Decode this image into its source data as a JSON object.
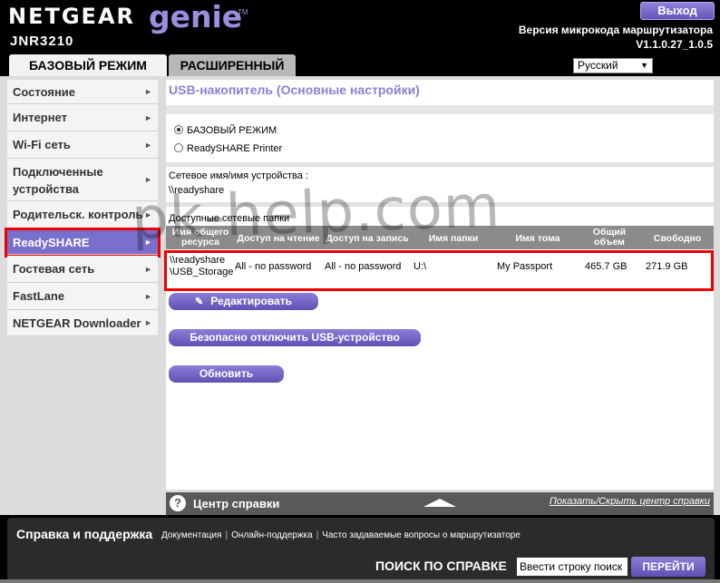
{
  "header": {
    "brand": "NETGEAR",
    "product": "genie",
    "trademark": "TM",
    "model": "JNR3210",
    "logout_label": "Выход",
    "firmware_label": "Версия микрокода маршрутизатора",
    "firmware_version": "V1.1.0.27_1.0.5"
  },
  "tabs": {
    "basic": "БАЗОВЫЙ РЕЖИМ",
    "advanced": "РАСШИРЕННЫЙ"
  },
  "language": {
    "selected": "Русский"
  },
  "sidebar": {
    "items": [
      {
        "label": "Состояние"
      },
      {
        "label": "Интернет"
      },
      {
        "label": "Wi-Fi сеть"
      },
      {
        "label": "Подключенные устройства"
      },
      {
        "label": "Родительск. контроль"
      },
      {
        "label": "ReadySHARE",
        "active": true
      },
      {
        "label": "Гостевая сеть"
      },
      {
        "label": "FastLane"
      },
      {
        "label": "NETGEAR Downloader"
      }
    ]
  },
  "main": {
    "title": "USB-накопитель (Основные настройки)",
    "radio_basic": "БАЗОВЫЙ РЕЖИМ",
    "radio_printer": "ReadySHARE Printer",
    "network_name_label": "Сетевое имя/имя устройства :",
    "network_name_value": "\\\\readyshare",
    "folders_label": "Доступные сетевые папки",
    "table": {
      "headers": [
        "Имя общего ресурса",
        "Доступ на чтение",
        "Доступ на запись",
        "Имя папки",
        "Имя тома",
        "Общий объем",
        "Свободно"
      ],
      "rows": [
        [
          "\\\\readyshare \\USB_Storage",
          "All - no password",
          "All - no password",
          "U:\\",
          "My Passport",
          "465.7 GB",
          "271.9 GB"
        ]
      ]
    },
    "edit_button": "Редактировать",
    "eject_button": "Безопасно отключить USB-устройство",
    "refresh_button": "Обновить"
  },
  "help": {
    "title": "Центр справки",
    "toggle": "Показать/Скрыть центр справки"
  },
  "footer": {
    "title": "Справка и поддержка",
    "links": [
      "Документация",
      "Онлайн-поддержка",
      "Часто задаваемые вопросы о маршрутизаторе"
    ],
    "search_label": "ПОИСК ПО СПРАВКЕ",
    "search_placeholder": "Ввести строку поиск",
    "go_button": "ПЕРЕЙТИ"
  },
  "watermark": "pk-help.com",
  "colors": {
    "accent": "#7a6fcc",
    "title": "#8a80d6",
    "highlight": "#e00000"
  }
}
